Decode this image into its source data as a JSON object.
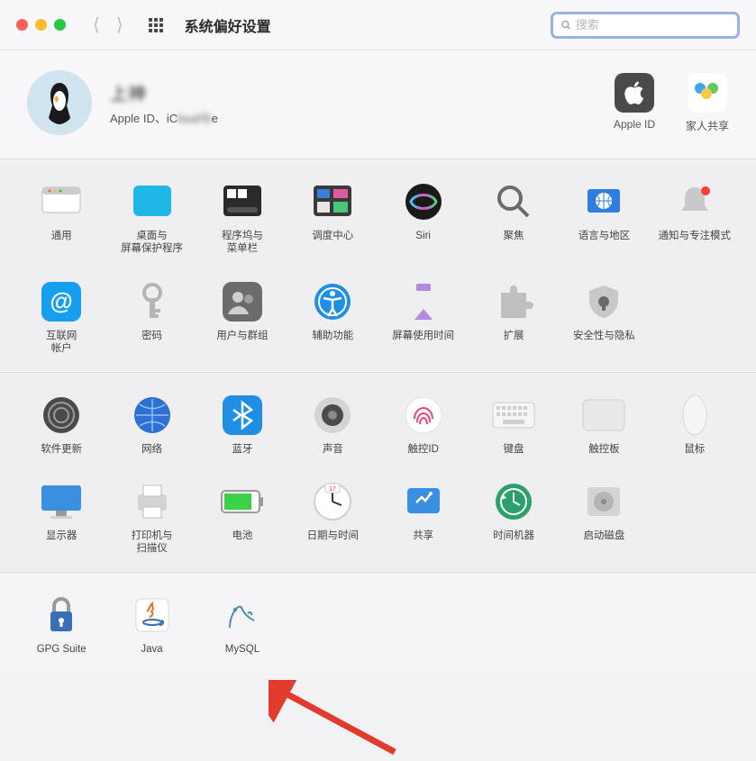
{
  "toolbar": {
    "title": "系统偏好设置",
    "search_placeholder": "搜索"
  },
  "account": {
    "name": "上神",
    "subtitle_prefix": "Apple ID、iC",
    "subtitle_blurred": "loud与",
    "subtitle_suffix": "e",
    "apple_id_label": "Apple ID",
    "family_label": "家人共享"
  },
  "sections": [
    {
      "items": [
        {
          "icon": "general",
          "label": "通用"
        },
        {
          "icon": "desktop",
          "label": "桌面与\n屏幕保护程序"
        },
        {
          "icon": "dock",
          "label": "程序坞与\n菜单栏"
        },
        {
          "icon": "mission-control",
          "label": "调度中心"
        },
        {
          "icon": "siri",
          "label": "Siri"
        },
        {
          "icon": "spotlight",
          "label": "聚焦"
        },
        {
          "icon": "language",
          "label": "语言与地区"
        },
        {
          "icon": "notifications",
          "label": "通知与专注模式"
        },
        {
          "icon": "internet-accounts",
          "label": "互联网\n帐户"
        },
        {
          "icon": "passwords",
          "label": "密码"
        },
        {
          "icon": "users-groups",
          "label": "用户与群组"
        },
        {
          "icon": "accessibility",
          "label": "辅助功能"
        },
        {
          "icon": "screen-time",
          "label": "屏幕使用时间"
        },
        {
          "icon": "extensions",
          "label": "扩展"
        },
        {
          "icon": "security",
          "label": "安全性与隐私"
        }
      ]
    },
    {
      "items": [
        {
          "icon": "software-update",
          "label": "软件更新"
        },
        {
          "icon": "network",
          "label": "网络"
        },
        {
          "icon": "bluetooth",
          "label": "蓝牙"
        },
        {
          "icon": "sound",
          "label": "声音"
        },
        {
          "icon": "touch-id",
          "label": "触控ID"
        },
        {
          "icon": "keyboard",
          "label": "键盘"
        },
        {
          "icon": "trackpad",
          "label": "触控板"
        },
        {
          "icon": "mouse",
          "label": "鼠标"
        },
        {
          "icon": "displays",
          "label": "显示器"
        },
        {
          "icon": "printers",
          "label": "打印机与\n扫描仪"
        },
        {
          "icon": "battery",
          "label": "电池"
        },
        {
          "icon": "date-time",
          "label": "日期与时间"
        },
        {
          "icon": "sharing",
          "label": "共享"
        },
        {
          "icon": "time-machine",
          "label": "时间机器"
        },
        {
          "icon": "startup-disk",
          "label": "启动磁盘"
        }
      ]
    },
    {
      "items": [
        {
          "icon": "gpg-suite",
          "label": "GPG Suite"
        },
        {
          "icon": "java",
          "label": "Java"
        },
        {
          "icon": "mysql",
          "label": "MySQL"
        }
      ]
    }
  ]
}
